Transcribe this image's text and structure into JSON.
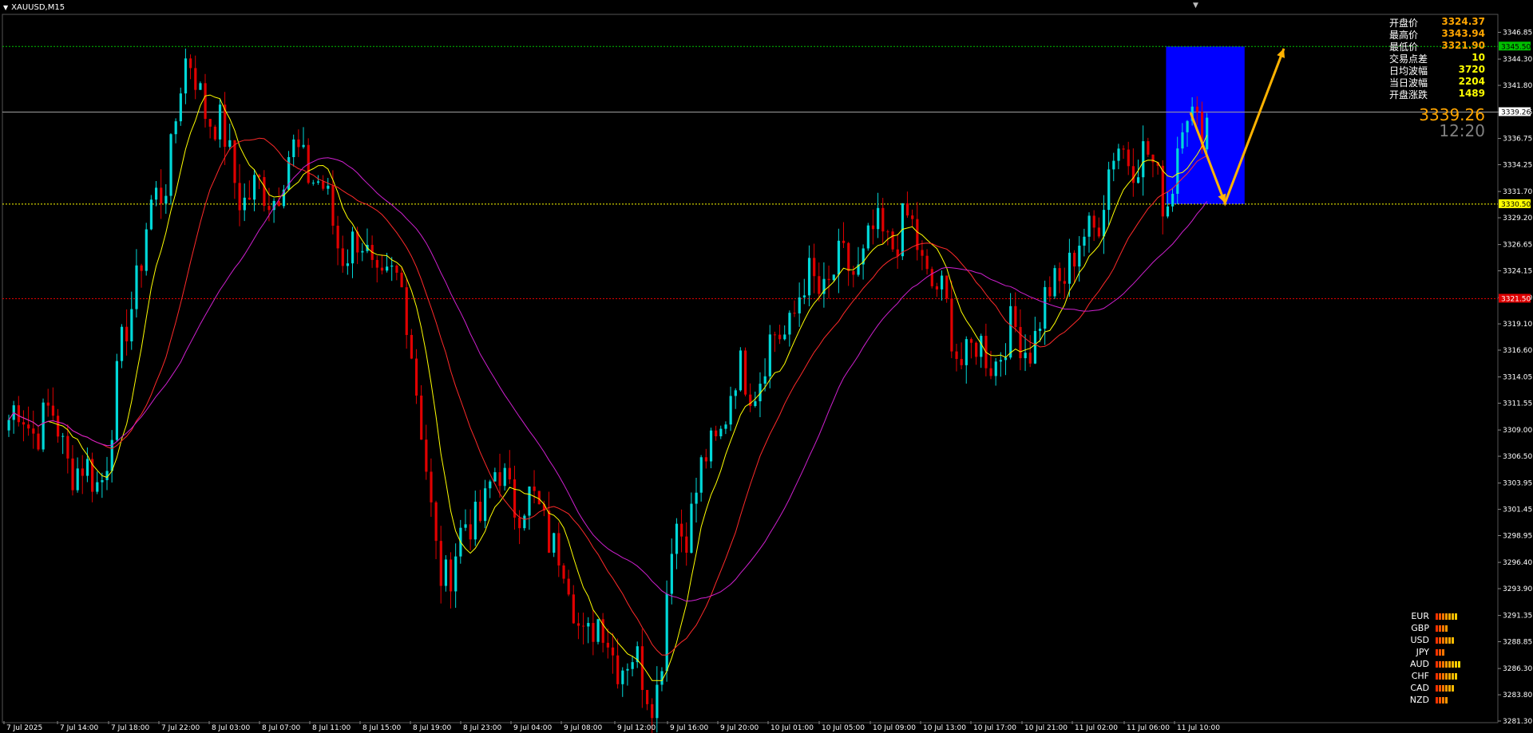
{
  "header": {
    "symbol_label": "XAUUSD,M15"
  },
  "info_panel": [
    {
      "label": "开盘价",
      "value": "3324.37",
      "style": "orange"
    },
    {
      "label": "最高价",
      "value": "3343.94",
      "style": "orange"
    },
    {
      "label": "最低价",
      "value": "3321.90",
      "style": "orange"
    },
    {
      "label": "交易点差",
      "value": "10",
      "style": "yellow"
    },
    {
      "label": "日均波幅",
      "value": "3720",
      "style": "yellow"
    },
    {
      "label": "当日波幅",
      "value": "2204",
      "style": "yellow"
    },
    {
      "label": "开盘涨跌",
      "value": "1489",
      "style": "yellow"
    }
  ],
  "current": {
    "price": "3339.26",
    "time": "12:20"
  },
  "currency_strength": [
    {
      "name": "EUR",
      "strength": 7
    },
    {
      "name": "GBP",
      "strength": 4
    },
    {
      "name": "USD",
      "strength": 6
    },
    {
      "name": "JPY",
      "strength": 3
    },
    {
      "name": "AUD",
      "strength": 8
    },
    {
      "name": "CHF",
      "strength": 7
    },
    {
      "name": "CAD",
      "strength": 6
    },
    {
      "name": "NZD",
      "strength": 4
    }
  ],
  "colors": {
    "background": "#000000",
    "bull_candle": "#00d8d8",
    "bear_candle": "#e00000",
    "ma_fast": "#ffff00",
    "ma_mid": "#ff2a2a",
    "ma_slow": "#d020d0",
    "zone": "#0000ff",
    "arrow": "#ffb300",
    "resistance_line": "#00c000",
    "support_line": "#ffff00",
    "lower_line": "#e00000",
    "price_line": "#a0a0a0"
  },
  "chart_data": {
    "type": "candlestick",
    "symbol": "XAUUSD",
    "timeframe": "M15",
    "ylim": [
      3281.3,
      3347.8
    ],
    "y_ticks": [
      "3346.85",
      "3344.30",
      "3341.80",
      "3339.26",
      "3336.75",
      "3334.25",
      "3331.70",
      "3329.20",
      "3326.65",
      "3324.15",
      "3321.60",
      "3319.10",
      "3316.60",
      "3314.05",
      "3311.55",
      "3309.00",
      "3306.50",
      "3303.95",
      "3301.45",
      "3298.95",
      "3296.40",
      "3293.90",
      "3291.35",
      "3288.85",
      "3286.30",
      "3283.80",
      "3281.30"
    ],
    "x_ticks": [
      "7 Jul 2025",
      "7 Jul 14:00",
      "7 Jul 18:00",
      "7 Jul 22:00",
      "8 Jul 03:00",
      "8 Jul 07:00",
      "8 Jul 11:00",
      "8 Jul 15:00",
      "8 Jul 19:00",
      "8 Jul 23:00",
      "9 Jul 04:00",
      "9 Jul 08:00",
      "9 Jul 12:00",
      "9 Jul 16:00",
      "9 Jul 20:00",
      "10 Jul 01:00",
      "10 Jul 05:00",
      "10 Jul 09:00",
      "10 Jul 13:00",
      "10 Jul 17:00",
      "10 Jul 21:00",
      "11 Jul 02:00",
      "11 Jul 06:00",
      "11 Jul 10:00"
    ],
    "levels": [
      {
        "name": "resistance",
        "value": 3345.5,
        "label": "3345.50"
      },
      {
        "name": "current",
        "value": 3339.26,
        "label": "3339.26"
      },
      {
        "name": "support",
        "value": 3330.5,
        "label": "3330.50"
      },
      {
        "name": "lower",
        "value": 3321.5,
        "label": "3321.50"
      }
    ],
    "zone": {
      "y_top": 3345.5,
      "y_bottom": 3330.5
    },
    "key_points": [
      {
        "bar": 7,
        "price": 3310
      },
      {
        "bar": 17,
        "price": 3304
      },
      {
        "bar": 30,
        "price": 3330
      },
      {
        "bar": 36,
        "price": 3343
      },
      {
        "bar": 50,
        "price": 3331
      },
      {
        "bar": 60,
        "price": 3335
      },
      {
        "bar": 68,
        "price": 3327
      },
      {
        "bar": 80,
        "price": 3322
      },
      {
        "bar": 88,
        "price": 3296
      },
      {
        "bar": 100,
        "price": 3304
      },
      {
        "bar": 108,
        "price": 3301
      },
      {
        "bar": 118,
        "price": 3290
      },
      {
        "bar": 132,
        "price": 3285
      },
      {
        "bar": 136,
        "price": 3300
      },
      {
        "bar": 150,
        "price": 3314
      },
      {
        "bar": 165,
        "price": 3323
      },
      {
        "bar": 182,
        "price": 3328
      },
      {
        "bar": 196,
        "price": 3316
      },
      {
        "bar": 208,
        "price": 3318
      },
      {
        "bar": 216,
        "price": 3325
      },
      {
        "bar": 228,
        "price": 3336
      },
      {
        "bar": 236,
        "price": 3332
      },
      {
        "bar": 240,
        "price": 3339
      }
    ]
  }
}
